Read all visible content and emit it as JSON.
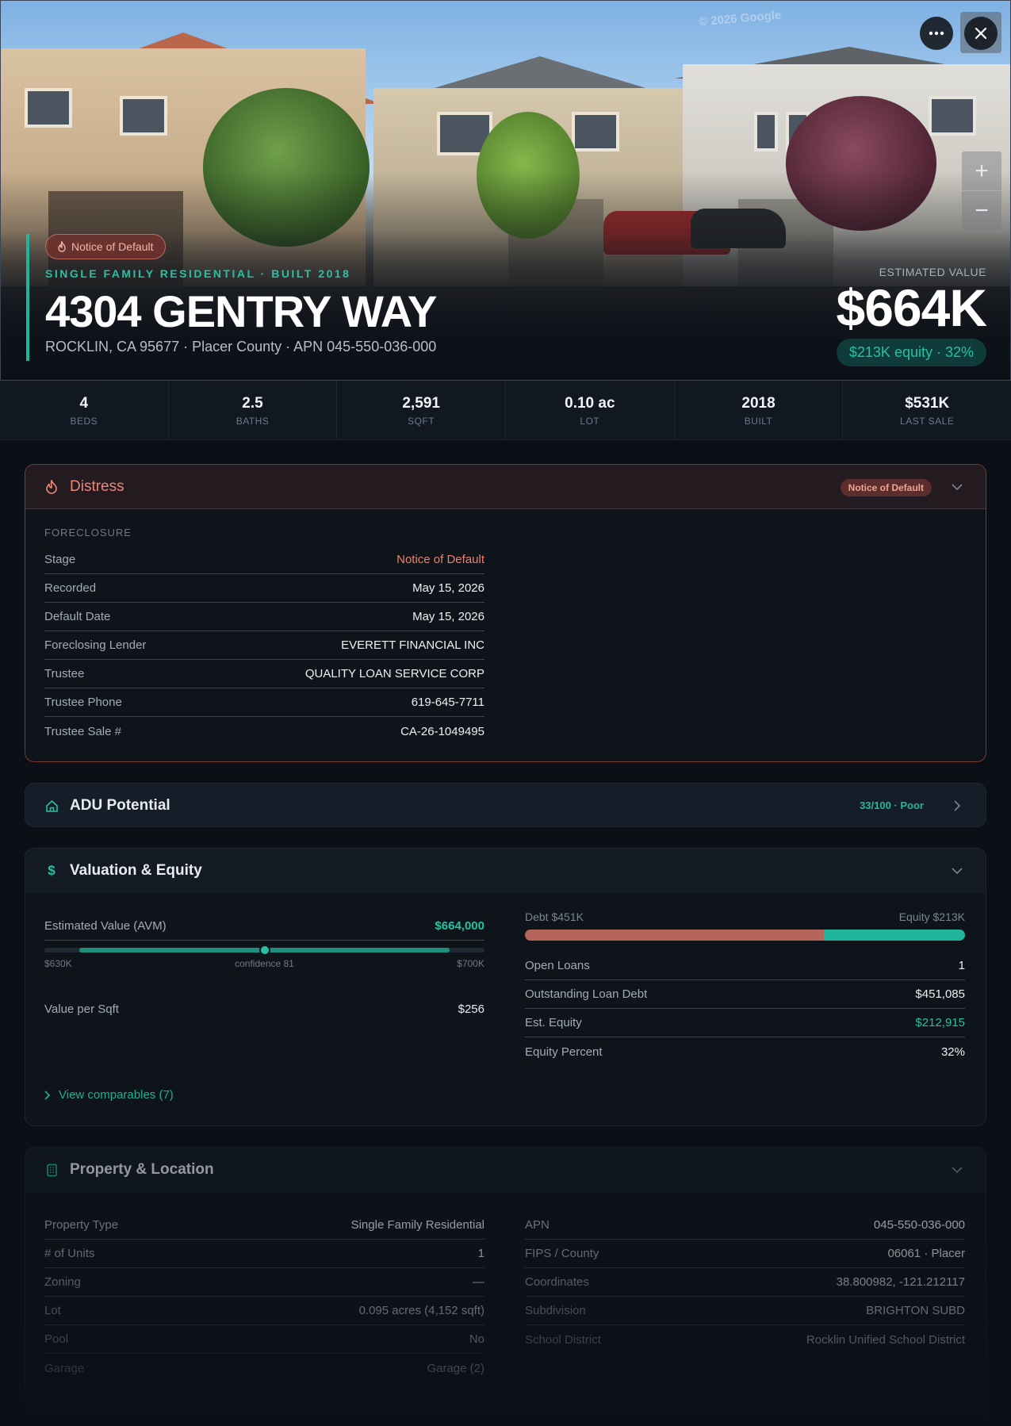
{
  "hero": {
    "watermark": "© 2026 Google",
    "distress_badge": "Notice of Default",
    "subline": "SINGLE FAMILY RESIDENTIAL · BUILT 2018",
    "address": "4304 GENTRY WAY",
    "location": "ROCKLIN, CA 95677 · Placer County · APN 045-550-036-000",
    "estimated_value_label": "ESTIMATED VALUE",
    "estimated_value": "$664K",
    "equity_pill": "$213K equity · 32%",
    "more_icon": "more-horizontal-icon",
    "close_icon": "close-icon",
    "zoom_in": "+",
    "zoom_out": "−"
  },
  "stats": [
    {
      "value": "4",
      "label": "BEDS"
    },
    {
      "value": "2.5",
      "label": "BATHS"
    },
    {
      "value": "2,591",
      "label": "SQFT"
    },
    {
      "value": "0.10 ac",
      "label": "LOT"
    },
    {
      "value": "2018",
      "label": "BUILT"
    },
    {
      "value": "$531K",
      "label": "LAST SALE"
    }
  ],
  "distress": {
    "title": "Distress",
    "icon": "flame-icon",
    "badge": "Notice of Default",
    "section_label": "FORECLOSURE",
    "rows": [
      {
        "key": "Stage",
        "value": "Notice of Default"
      },
      {
        "key": "Recorded",
        "value": "May 15, 2026"
      },
      {
        "key": "Default Date",
        "value": "May 15, 2026"
      },
      {
        "key": "Foreclosing Lender",
        "value": "EVERETT FINANCIAL INC"
      },
      {
        "key": "Trustee",
        "value": "QUALITY LOAN SERVICE CORP"
      },
      {
        "key": "Trustee Phone",
        "value": "619-645-7711"
      },
      {
        "key": "Trustee Sale #",
        "value": "CA-26-1049495"
      }
    ]
  },
  "adu": {
    "title": "ADU Potential",
    "icon": "home-icon",
    "score": "33/100 · Poor"
  },
  "valuation": {
    "title": "Valuation & Equity",
    "icon": "dollar-icon",
    "avm_label": "Estimated Value (AVM)",
    "avm_value": "$664,000",
    "range_low": "$630K",
    "range_high": "$700K",
    "confidence": "confidence 81",
    "range_start_fraction": 0.08,
    "range_end_fraction": 0.92,
    "value_fraction": 0.5,
    "vps_label": "Value per Sqft",
    "vps_value": "$256",
    "debt_label": "Debt $451K",
    "equity_label": "Equity $213K",
    "debt_fraction": 0.68,
    "rows": [
      {
        "key": "Open Loans",
        "value": "1"
      },
      {
        "key": "Outstanding Loan Debt",
        "value": "$451,085"
      },
      {
        "key": "Est. Equity",
        "value": "$212,915"
      },
      {
        "key": "Equity Percent",
        "value": "32%"
      }
    ],
    "comps_link": "View comparables (7)"
  },
  "property": {
    "title": "Property & Location",
    "icon": "building-icon",
    "left_rows": [
      {
        "key": "Property Type",
        "value": "Single Family Residential"
      },
      {
        "key": "# of Units",
        "value": "1"
      },
      {
        "key": "Zoning",
        "value": "—"
      },
      {
        "key": "Lot",
        "value": "0.095 acres (4,152 sqft)"
      },
      {
        "key": "Pool",
        "value": "No"
      },
      {
        "key": "Garage",
        "value": "Garage (2)"
      }
    ],
    "right_rows": [
      {
        "key": "APN",
        "value": "045-550-036-000"
      },
      {
        "key": "FIPS / County",
        "value": "06061 · Placer"
      },
      {
        "key": "Coordinates",
        "value": "38.800982, -121.212117"
      },
      {
        "key": "Subdivision",
        "value": "BRIGHTON SUBD"
      },
      {
        "key": "School District",
        "value": "Rocklin Unified School District"
      }
    ]
  },
  "colors": {
    "accent": "#27c0a5",
    "distress": "#ef7e6c",
    "debt": "#b5655c",
    "background": "#0c1016"
  }
}
